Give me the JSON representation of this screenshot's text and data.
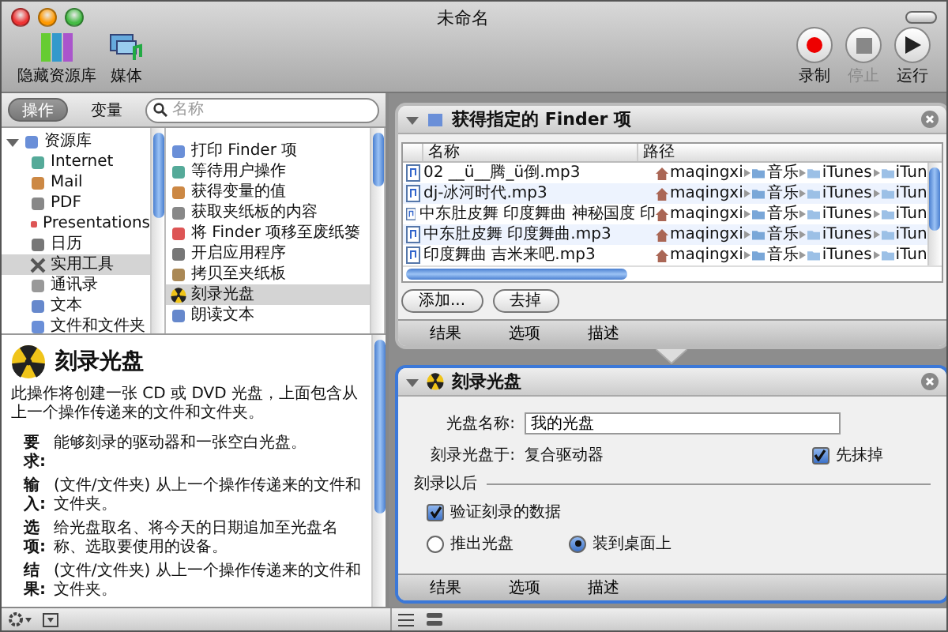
{
  "window": {
    "title": "未命名"
  },
  "toolbar": {
    "left": [
      {
        "label": "隐藏资源库",
        "kind": "library"
      },
      {
        "label": "媒体",
        "kind": "media"
      }
    ],
    "right": [
      {
        "label": "录制",
        "kind": "record",
        "disabled": false
      },
      {
        "label": "停止",
        "kind": "stop",
        "disabled": true
      },
      {
        "label": "运行",
        "kind": "run",
        "disabled": false
      }
    ]
  },
  "library": {
    "tabs": [
      {
        "label": "操作",
        "selected": true
      },
      {
        "label": "变量",
        "selected": false
      }
    ],
    "search": {
      "placeholder": "名称"
    },
    "categories": [
      {
        "label": "资源库",
        "expanded": true,
        "selected": false,
        "children": [
          {
            "label": "Internet",
            "selected": false
          },
          {
            "label": "Mail",
            "selected": false
          },
          {
            "label": "PDF",
            "selected": false
          },
          {
            "label": "Presentations",
            "selected": false
          },
          {
            "label": "日历",
            "selected": false
          },
          {
            "label": "实用工具",
            "selected": true
          },
          {
            "label": "通讯录",
            "selected": false
          },
          {
            "label": "文本",
            "selected": false
          },
          {
            "label": "文件和文件夹",
            "selected": false
          }
        ]
      }
    ],
    "actions": [
      {
        "label": "打印 Finder 项",
        "selected": false
      },
      {
        "label": "等待用户操作",
        "selected": false
      },
      {
        "label": "获得变量的值",
        "selected": false
      },
      {
        "label": "获取夹纸板的内容",
        "selected": false
      },
      {
        "label": "将 Finder 项移至废纸篓",
        "selected": false
      },
      {
        "label": "开启应用程序",
        "selected": false
      },
      {
        "label": "拷贝至夹纸板",
        "selected": false
      },
      {
        "label": "刻录光盘",
        "selected": true
      },
      {
        "label": "朗读文本",
        "selected": false
      }
    ]
  },
  "description": {
    "title": "刻录光盘",
    "intro": "此操作将创建一张 CD 或 DVD 光盘，上面包含从上一个操作传递来的文件和文件夹。",
    "fields": [
      {
        "label": "要求:",
        "text": "能够刻录的驱动器和一张空白光盘。"
      },
      {
        "label": "输入:",
        "text": "(文件/文件夹) 从上一个操作传递来的文件和文件夹。"
      },
      {
        "label": "选项:",
        "text": "给光盘取名、将今天的日期追加至光盘名称、选取要使用的设备。"
      },
      {
        "label": "结果:",
        "text": "(文件/文件夹) 从上一个操作传递来的文件和文件夹。"
      }
    ]
  },
  "workflow": [
    {
      "kind": "files",
      "title": "获得指定的 Finder 项",
      "expanded": true,
      "selected": false,
      "columns": [
        "名称",
        "路径"
      ],
      "rows": [
        {
          "name": "02 __ü__腾_ü倒.mp3",
          "path": [
            "maqingxi",
            "音乐",
            "iTunes",
            "iTun"
          ]
        },
        {
          "name": "dj-冰河时代.mp3",
          "path": [
            "maqingxi",
            "音乐",
            "iTunes",
            "iTun"
          ]
        },
        {
          "name": "中东肚皮舞 印度舞曲 神秘国度 印",
          "path": [
            "maqingxi",
            "音乐",
            "iTunes",
            "iTun"
          ]
        },
        {
          "name": "中东肚皮舞 印度舞曲.mp3",
          "path": [
            "maqingxi",
            "音乐",
            "iTunes",
            "iTun"
          ]
        },
        {
          "name": "印度舞曲 吉米来吧.mp3",
          "path": [
            "maqingxi",
            "音乐",
            "iTunes",
            "iTun"
          ]
        }
      ],
      "buttons": [
        "添加...",
        "去掉"
      ],
      "footer": [
        "结果",
        "选项",
        "描述"
      ]
    },
    {
      "kind": "burn",
      "title": "刻录光盘",
      "expanded": true,
      "selected": true,
      "disc_name": {
        "label": "光盘名称:",
        "value": "我的光盘"
      },
      "burn_in": {
        "label": "刻录光盘于:",
        "value": "复合驱动器"
      },
      "erase": {
        "label": "先抹掉",
        "checked": true
      },
      "after": {
        "label": "刻录以后",
        "verify": {
          "label": "验证刻录的数据",
          "checked": true
        },
        "options": [
          {
            "label": "推出光盘",
            "selected": false
          },
          {
            "label": "装到桌面上",
            "selected": true
          }
        ]
      },
      "footer": [
        "结果",
        "选项",
        "描述"
      ]
    }
  ]
}
